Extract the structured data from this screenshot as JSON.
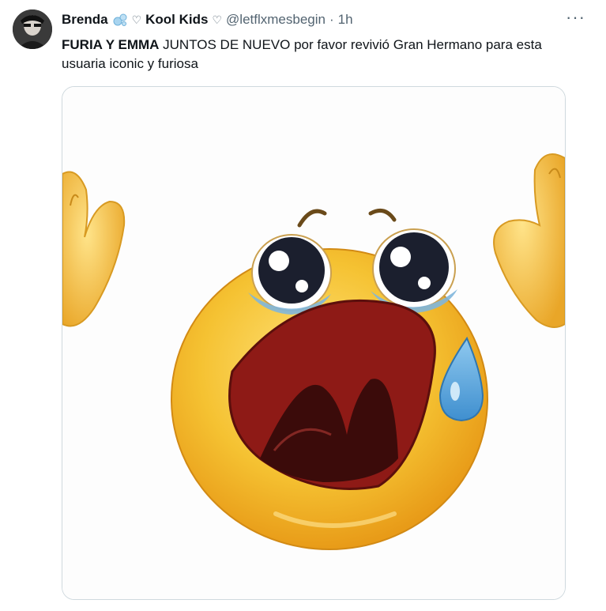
{
  "tweet": {
    "display_name": "Brenda",
    "name_suffix": "Kool Kids",
    "heart_glyph": "♡",
    "handle": "@letflxmesbegin",
    "separator": "·",
    "time": "1h",
    "more_glyph": "···",
    "text_bold": "FURIA Y EMMA",
    "text_rest": " JUNTOS DE NUEVO por favor revivió Gran Hermano para esta usuaria iconic y furiosa"
  },
  "media": {
    "description_icon": "crying-emoji-image"
  },
  "colors": {
    "text": "#0f1419",
    "secondary": "#536471",
    "border": "#cfd9de",
    "emoji_yellow": "#f6c234",
    "tear_blue": "#5aa6d8",
    "mouth_red": "#8e1a16"
  }
}
